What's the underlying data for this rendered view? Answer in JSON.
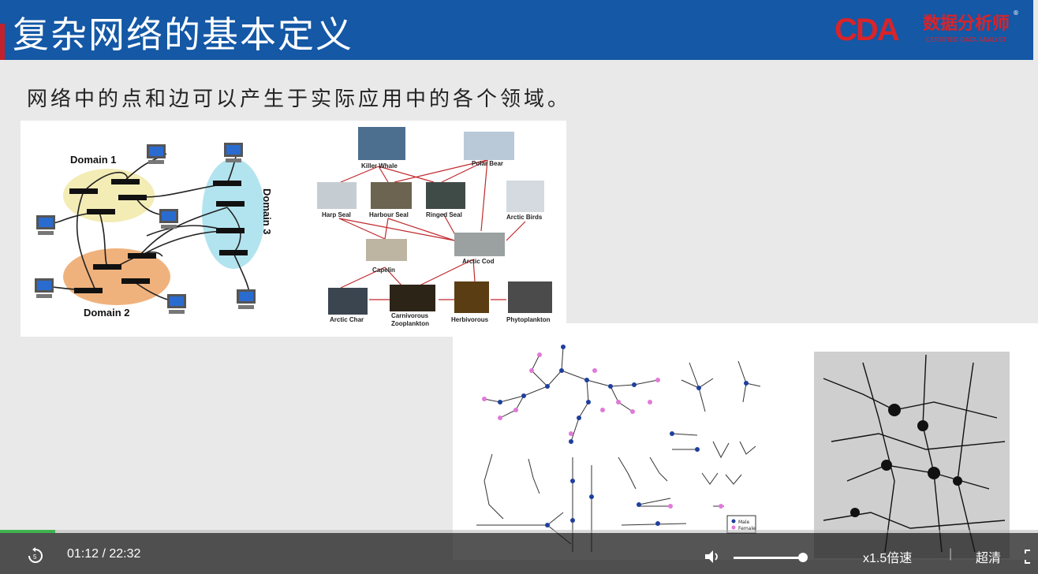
{
  "slide": {
    "title": "复杂网络的基本定义",
    "subtitle": "网络中的点和边可以产生于实际应用中的各个领域。",
    "logo": {
      "cda": "CDA",
      "cn": "数据分析师",
      "en": "CERTIFIED DATA ANALYST",
      "reg": "®"
    }
  },
  "computer_network": {
    "domain1": "Domain 1",
    "domain2": "Domain 2",
    "domain3": "Domain 3"
  },
  "food_web": {
    "nodes": {
      "killer_whale": "Killer Whale",
      "polar_bear": "Polar Bear",
      "harp_seal": "Harp Seal",
      "harbour_seal": "Harbour Seal",
      "ringed_seal": "Ringed Seal",
      "arctic_birds": "Arctic Birds",
      "capelin": "Capelin",
      "arctic_cod": "Arctic Cod",
      "arctic_char": "Arctic Char",
      "carnivorous": "Carnivorous",
      "zooplankton": "Zooplankton",
      "herbivorous": "Herbivorous",
      "phytoplankton": "Phytoplankton"
    }
  },
  "social_network": {
    "legend_male": "Male",
    "legend_female": "Female",
    "colors": {
      "male": "#1f3f9e",
      "female": "#e07ad8"
    }
  },
  "player": {
    "time": "01:12 / 22:32",
    "speed": "x1.5倍速",
    "separator": "|",
    "quality": "超清",
    "progress_fraction": 0.053,
    "volume_fraction": 0.93,
    "icons": [
      "replay-icon",
      "volume-icon",
      "fullscreen-icon"
    ]
  }
}
